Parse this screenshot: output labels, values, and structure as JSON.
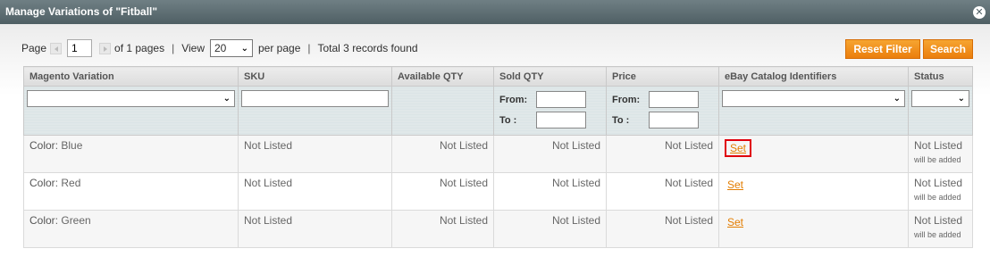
{
  "dialog": {
    "title": "Manage Variations of \"Fitball\""
  },
  "pager": {
    "page_label": "Page",
    "page_value": "1",
    "of_pages": "of 1 pages",
    "view_label": "View",
    "view_value": "20",
    "per_page": "per page",
    "records": "Total 3 records found"
  },
  "buttons": {
    "reset": "Reset Filter",
    "search": "Search"
  },
  "columns": [
    "Magento Variation",
    "SKU",
    "Available QTY",
    "Sold QTY",
    "Price",
    "eBay Catalog Identifiers",
    "Status"
  ],
  "filters": {
    "from_label": "From:",
    "to_label": "To :"
  },
  "rows": [
    {
      "attr": "Color",
      "value": ": Blue",
      "sku": "Not Listed",
      "available": "Not Listed",
      "sold": "Not Listed",
      "price": "Not Listed",
      "identifiers": "Set",
      "status": "Not Listed",
      "note": "will be added"
    },
    {
      "attr": "Color",
      "value": ": Red",
      "sku": "Not Listed",
      "available": "Not Listed",
      "sold": "Not Listed",
      "price": "Not Listed",
      "identifiers": "Set",
      "status": "Not Listed",
      "note": "will be added"
    },
    {
      "attr": "Color",
      "value": ": Green",
      "sku": "Not Listed",
      "available": "Not Listed",
      "sold": "Not Listed",
      "price": "Not Listed",
      "identifiers": "Set",
      "status": "Not Listed",
      "note": "will be added"
    }
  ],
  "colors": {
    "accent": "#eb7e0d",
    "link": "#e37d00",
    "highlight": "#e0000c"
  },
  "icons": {
    "close": "close-icon",
    "prev": "prev-arrow-icon",
    "next": "next-arrow-icon",
    "dropdown": "chevron-down-icon"
  }
}
